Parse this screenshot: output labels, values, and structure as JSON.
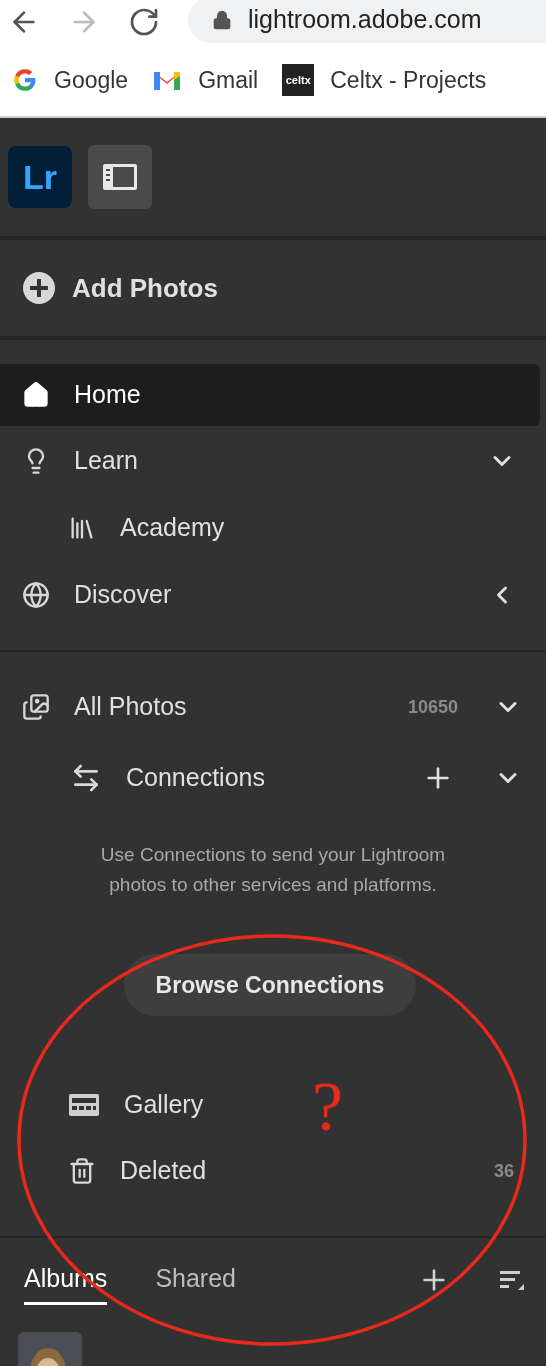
{
  "browser": {
    "url": "lightroom.adobe.com",
    "back_enabled": true,
    "forward_enabled": false
  },
  "bookmarks": [
    {
      "kind": "google",
      "label": "Google"
    },
    {
      "kind": "gmail",
      "label": "Gmail"
    },
    {
      "kind": "celtx",
      "label": "Celtx - Projects",
      "icon_text": "celtx"
    }
  ],
  "app_bar": {
    "logo": "Lr"
  },
  "add_photos": {
    "label": "Add Photos"
  },
  "nav": [
    {
      "kind": "home",
      "label": "Home",
      "selected": true
    },
    {
      "kind": "learn",
      "label": "Learn",
      "selected": false,
      "expanded": true,
      "children": [
        {
          "kind": "academy",
          "label": "Academy",
          "selected": false
        }
      ]
    },
    {
      "kind": "discover",
      "label": "Discover",
      "selected": false,
      "expanded": false
    }
  ],
  "library": {
    "all_photos": {
      "label": "All Photos",
      "count": "10650",
      "selected": false,
      "expanded": true
    },
    "connections": {
      "label": "Connections",
      "selected": false,
      "expanded": true
    },
    "description": "Use Connections to send your Lightroom photos to other services and platforms.",
    "browse_button": "Browse Connections",
    "items": [
      {
        "kind": "gallery",
        "label": "Gallery",
        "selected": false
      },
      {
        "kind": "deleted",
        "label": "Deleted",
        "count": "36",
        "selected": false
      }
    ]
  },
  "tabs": [
    {
      "label": "Albums",
      "selected": true
    },
    {
      "label": "Shared",
      "selected": false
    }
  ],
  "annotation": {
    "mark": "?"
  }
}
